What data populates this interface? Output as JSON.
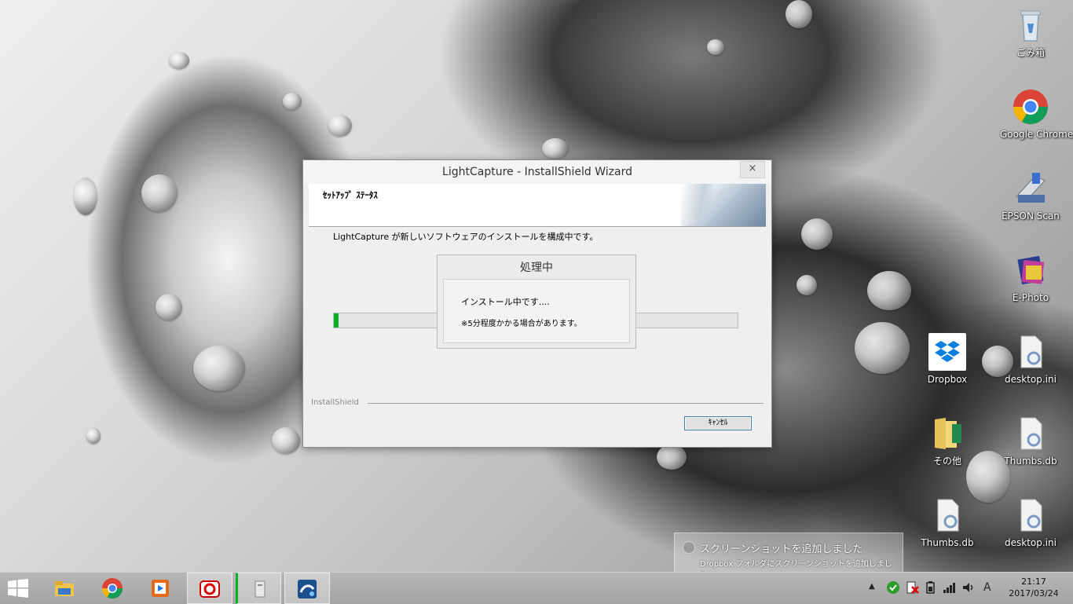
{
  "desktop": {
    "icons": [
      {
        "label": "ごみ箱",
        "icon": "recycle-bin-icon"
      },
      {
        "label": "Google Chrome",
        "icon": "chrome-icon"
      },
      {
        "label": "EPSON Scan",
        "icon": "scanner-icon"
      },
      {
        "label": "E-Photo",
        "icon": "photo-app-icon"
      },
      {
        "label": "Dropbox",
        "icon": "dropbox-icon"
      },
      {
        "label": "desktop.ini",
        "icon": "settings-file-icon"
      },
      {
        "label": "その他",
        "icon": "folder-icon"
      },
      {
        "label": "Thumbs.db",
        "icon": "settings-file-icon"
      },
      {
        "label": "Thumbs.db",
        "icon": "settings-file-icon"
      },
      {
        "label": "desktop.ini",
        "icon": "settings-file-icon"
      }
    ]
  },
  "dialog": {
    "title": "LightCapture - InstallShield Wizard",
    "close": "×",
    "banner_title": "ｾｯﾄｱｯﾌﾟ ｽﾃｰﾀｽ",
    "description": "LightCapture が新しいソフトウェアのインストールを構成中です。",
    "progress_fraction": 0.01,
    "brand": "InstallShield",
    "cancel_label": "ｷｬﾝｾﾙ"
  },
  "popup": {
    "title": "処理中",
    "line1": "インストール中です....",
    "line2": "※5分程度かかる場合があります。"
  },
  "notification": {
    "title": "スクリーンショットを追加しました",
    "body": "Dropbox フォルダにスクリーンショットを追加しました。"
  },
  "taskbar": {
    "apps": [
      "start-icon",
      "file-explorer-icon",
      "chrome-icon",
      "media-player-icon",
      "capture-app-icon",
      "installer-icon",
      "setup-icon"
    ],
    "ime": "A",
    "time": "21:17",
    "date": "2017/03/24"
  },
  "colors": {
    "progress": "#06b025",
    "dialog_bg": "#efefef"
  }
}
